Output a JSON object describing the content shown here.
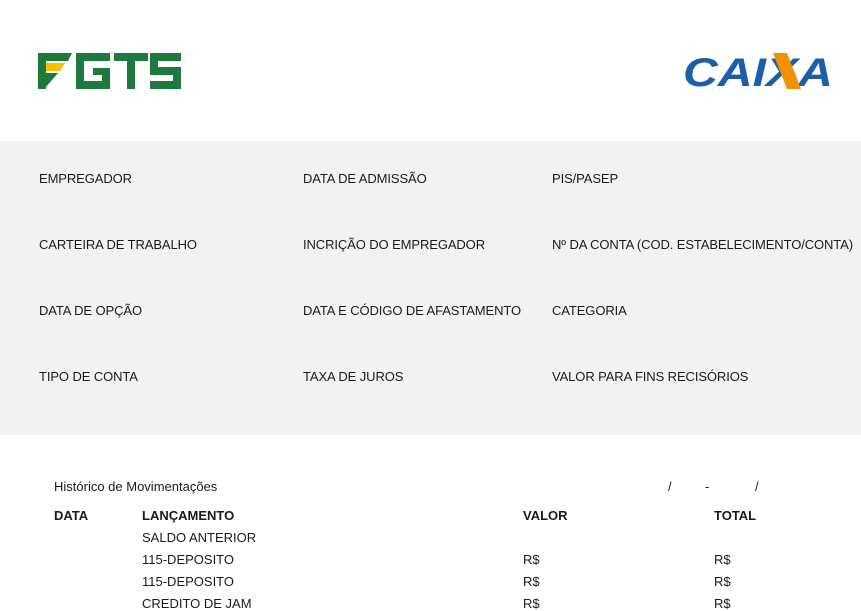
{
  "header": {
    "fgts_logo_text": "FGTS",
    "caixa_logo_text": "CAIXA",
    "colors": {
      "fgts_green": "#1e7a3c",
      "fgts_yellow": "#f2c400",
      "caixa_blue": "#1c5fa8",
      "caixa_orange": "#f39200"
    }
  },
  "info": {
    "col1": [
      "EMPREGADOR",
      "CARTEIRA DE TRABALHO",
      "DATA DE OPÇÃO",
      "TIPO DE CONTA"
    ],
    "col2": [
      "DATA DE ADMISSÃO",
      "INCRIÇÃO DO EMPREGADOR",
      "DATA E CÓDIGO DE AFASTAMENTO",
      "TAXA DE JUROS"
    ],
    "col3": [
      "PIS/PASEP",
      "Nº DA CONTA (COD. ESTABELECIMENTO/CONTA)",
      "CATEGORIA",
      "VALOR PARA FINS RECISÓRIOS"
    ]
  },
  "history": {
    "title": "Histórico de Movimentações",
    "date_sep1": "/",
    "date_sep2": "-",
    "date_sep3": "/",
    "columns": {
      "date": "DATA",
      "entry": "LANÇAMENTO",
      "value": "VALOR",
      "total": "TOTAL"
    },
    "rows": [
      {
        "entry": "SALDO ANTERIOR",
        "value": "",
        "total": ""
      },
      {
        "entry": "115-DEPOSITO",
        "value": "R$",
        "total": "R$"
      },
      {
        "entry": "115-DEPOSITO",
        "value": "R$",
        "total": "R$"
      },
      {
        "entry": "CREDITO DE JAM",
        "value": "R$",
        "total": "R$"
      }
    ]
  }
}
